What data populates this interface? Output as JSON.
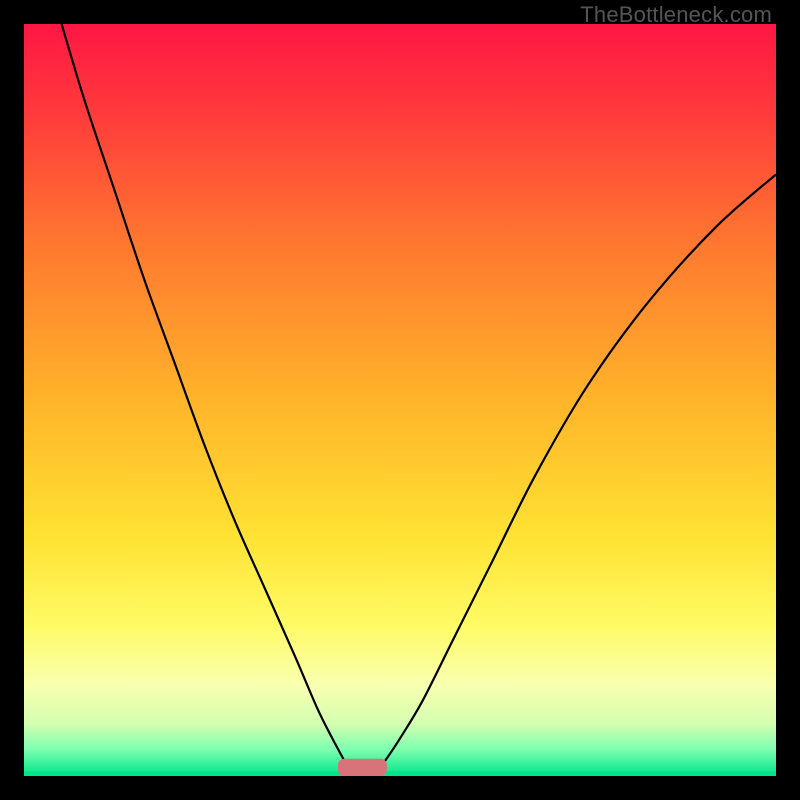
{
  "watermark": "TheBottleneck.com",
  "chart_data": {
    "type": "line",
    "title": "",
    "xlabel": "",
    "ylabel": "",
    "xlim": [
      0,
      100
    ],
    "ylim": [
      0,
      100
    ],
    "grid": false,
    "background_gradient_stops": [
      {
        "offset": 0.0,
        "color": "#ff1744"
      },
      {
        "offset": 0.12,
        "color": "#ff3b3b"
      },
      {
        "offset": 0.3,
        "color": "#ff7a2f"
      },
      {
        "offset": 0.5,
        "color": "#ffb42a"
      },
      {
        "offset": 0.68,
        "color": "#ffe233"
      },
      {
        "offset": 0.8,
        "color": "#fffb66"
      },
      {
        "offset": 0.88,
        "color": "#f8ffb0"
      },
      {
        "offset": 0.93,
        "color": "#d4ffb0"
      },
      {
        "offset": 0.965,
        "color": "#7cffb0"
      },
      {
        "offset": 1.0,
        "color": "#00e58a"
      }
    ],
    "series": [
      {
        "name": "left-branch",
        "x": [
          5,
          8,
          12,
          16,
          20,
          24,
          28,
          32,
          36,
          39,
          41,
          42.6,
          43.5
        ],
        "values": [
          100,
          90,
          78,
          66,
          55,
          44,
          34,
          25,
          16,
          9,
          5,
          2,
          0
        ]
      },
      {
        "name": "right-branch",
        "x": [
          46.5,
          48,
          50,
          53,
          57,
          62,
          68,
          75,
          83,
          92,
          100
        ],
        "values": [
          0,
          2,
          5,
          10,
          18,
          28,
          40,
          52,
          63,
          73,
          80
        ]
      }
    ],
    "marker": {
      "x_center": 45,
      "width": 6.5,
      "height": 2.3,
      "color": "#d9737a"
    },
    "green_baseline": {
      "height_fraction": 0.006,
      "color": "#00e58a"
    }
  }
}
